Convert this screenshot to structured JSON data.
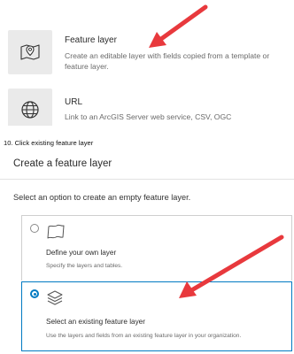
{
  "item_types": [
    {
      "icon": "map-pin-icon",
      "title": "Feature layer",
      "description": "Create an editable layer with fields copied from a template or feature layer."
    },
    {
      "icon": "globe-icon",
      "title": "URL",
      "description": "Link to an ArcGIS Server web service, CSV, OGC"
    }
  ],
  "step_caption": "10. Click existing feature layer",
  "dialog": {
    "title": "Create a feature layer",
    "subtitle": "Select an option to create an empty feature layer.",
    "options": [
      {
        "icon": "map-sheet-icon",
        "title": "Define your own layer",
        "description": "Specify the layers and tables.",
        "selected": false
      },
      {
        "icon": "layers-icon",
        "title": "Select an existing feature layer",
        "description": "Use the layers and fields from an existing feature layer in your organization.",
        "selected": true
      }
    ]
  },
  "colors": {
    "accent": "#007ac2",
    "annotation_arrow": "#e8393d",
    "card_icon_bg": "#eaeaea"
  }
}
